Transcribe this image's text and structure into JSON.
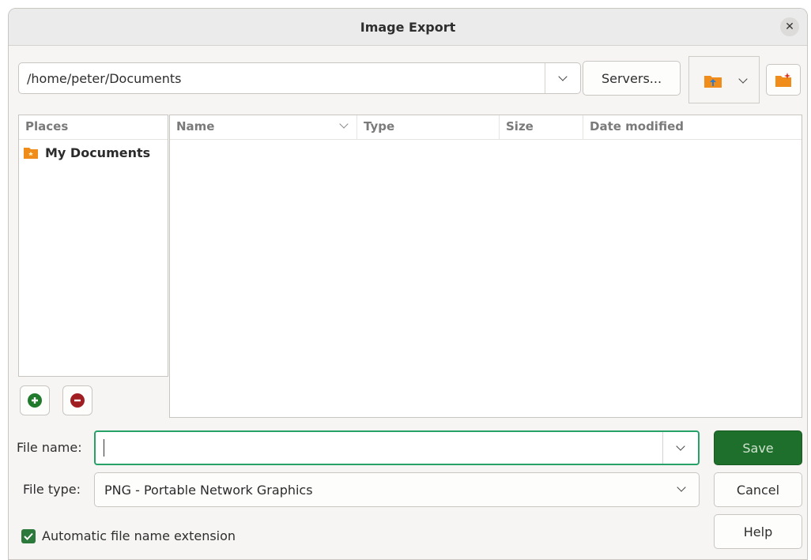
{
  "window": {
    "title": "Image Export"
  },
  "toolbar": {
    "path": "/home/peter/Documents",
    "servers_label": "Servers..."
  },
  "places": {
    "header": "Places",
    "items": [
      {
        "label": "My Documents",
        "icon": "folder-icon"
      }
    ]
  },
  "file_list": {
    "columns": [
      "Name",
      "Type",
      "Size",
      "Date modified"
    ],
    "rows": []
  },
  "form": {
    "file_name_label": "File name:",
    "file_name_value": "",
    "file_type_label": "File type:",
    "file_type_value": "PNG - Portable Network Graphics",
    "auto_extension_label": "Automatic file name extension",
    "auto_extension_checked": true
  },
  "buttons": {
    "save": "Save",
    "cancel": "Cancel",
    "help": "Help"
  },
  "colors": {
    "accent": "#26a269",
    "save_bg": "#1f6f2c",
    "folder": "#f08c1a"
  }
}
